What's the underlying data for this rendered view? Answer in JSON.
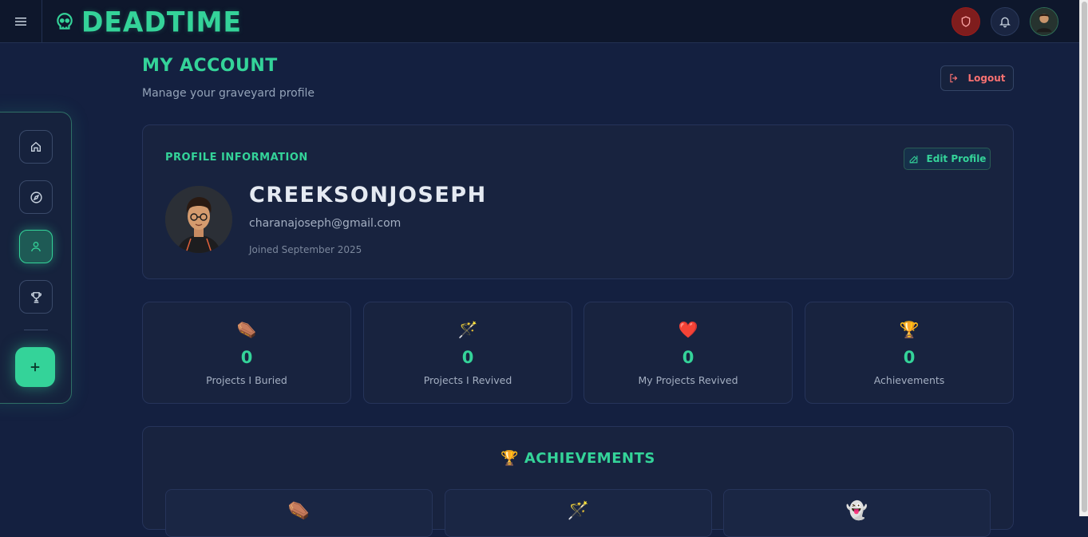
{
  "app": {
    "name": "DEADTIME",
    "logo_icon": "skull-icon"
  },
  "topbar": {
    "menu_icon": "hamburger-icon",
    "actions": [
      {
        "name": "shield-button",
        "icon": "shield-icon"
      },
      {
        "name": "notifications-button",
        "icon": "bell-icon"
      },
      {
        "name": "user-avatar-button",
        "icon": "avatar"
      }
    ]
  },
  "sidebar": {
    "items": [
      {
        "name": "home",
        "icon": "home-icon",
        "active": false
      },
      {
        "name": "explore",
        "icon": "compass-icon",
        "active": false
      },
      {
        "name": "account",
        "icon": "user-icon",
        "active": true
      },
      {
        "name": "leaderboard",
        "icon": "trophy-icon",
        "active": false
      }
    ],
    "add_icon": "plus-icon"
  },
  "header": {
    "title": "My Account",
    "subtitle": "Manage your graveyard profile",
    "logout_label": "Logout"
  },
  "profile": {
    "heading": "Profile Information",
    "edit_label": "Edit Profile",
    "username": "CreeksonJoseph",
    "email": "charanajoseph@gmail.com",
    "joined": "Joined September 2025"
  },
  "stats": [
    {
      "emoji": "⚰️",
      "value": "0",
      "label": "Projects I Buried"
    },
    {
      "emoji": "🪄",
      "value": "0",
      "label": "Projects I Revived"
    },
    {
      "emoji": "❤️",
      "value": "0",
      "label": "My Projects Revived"
    },
    {
      "emoji": "🏆",
      "value": "0",
      "label": "Achievements"
    }
  ],
  "achievements": {
    "heading": "Achievements",
    "heading_emoji": "🏆",
    "items": [
      {
        "emoji": "⚰️"
      },
      {
        "emoji": "🪄"
      },
      {
        "emoji": "👻"
      }
    ]
  },
  "colors": {
    "accent": "#34d399",
    "danger": "#f87171",
    "background": "#142040"
  }
}
